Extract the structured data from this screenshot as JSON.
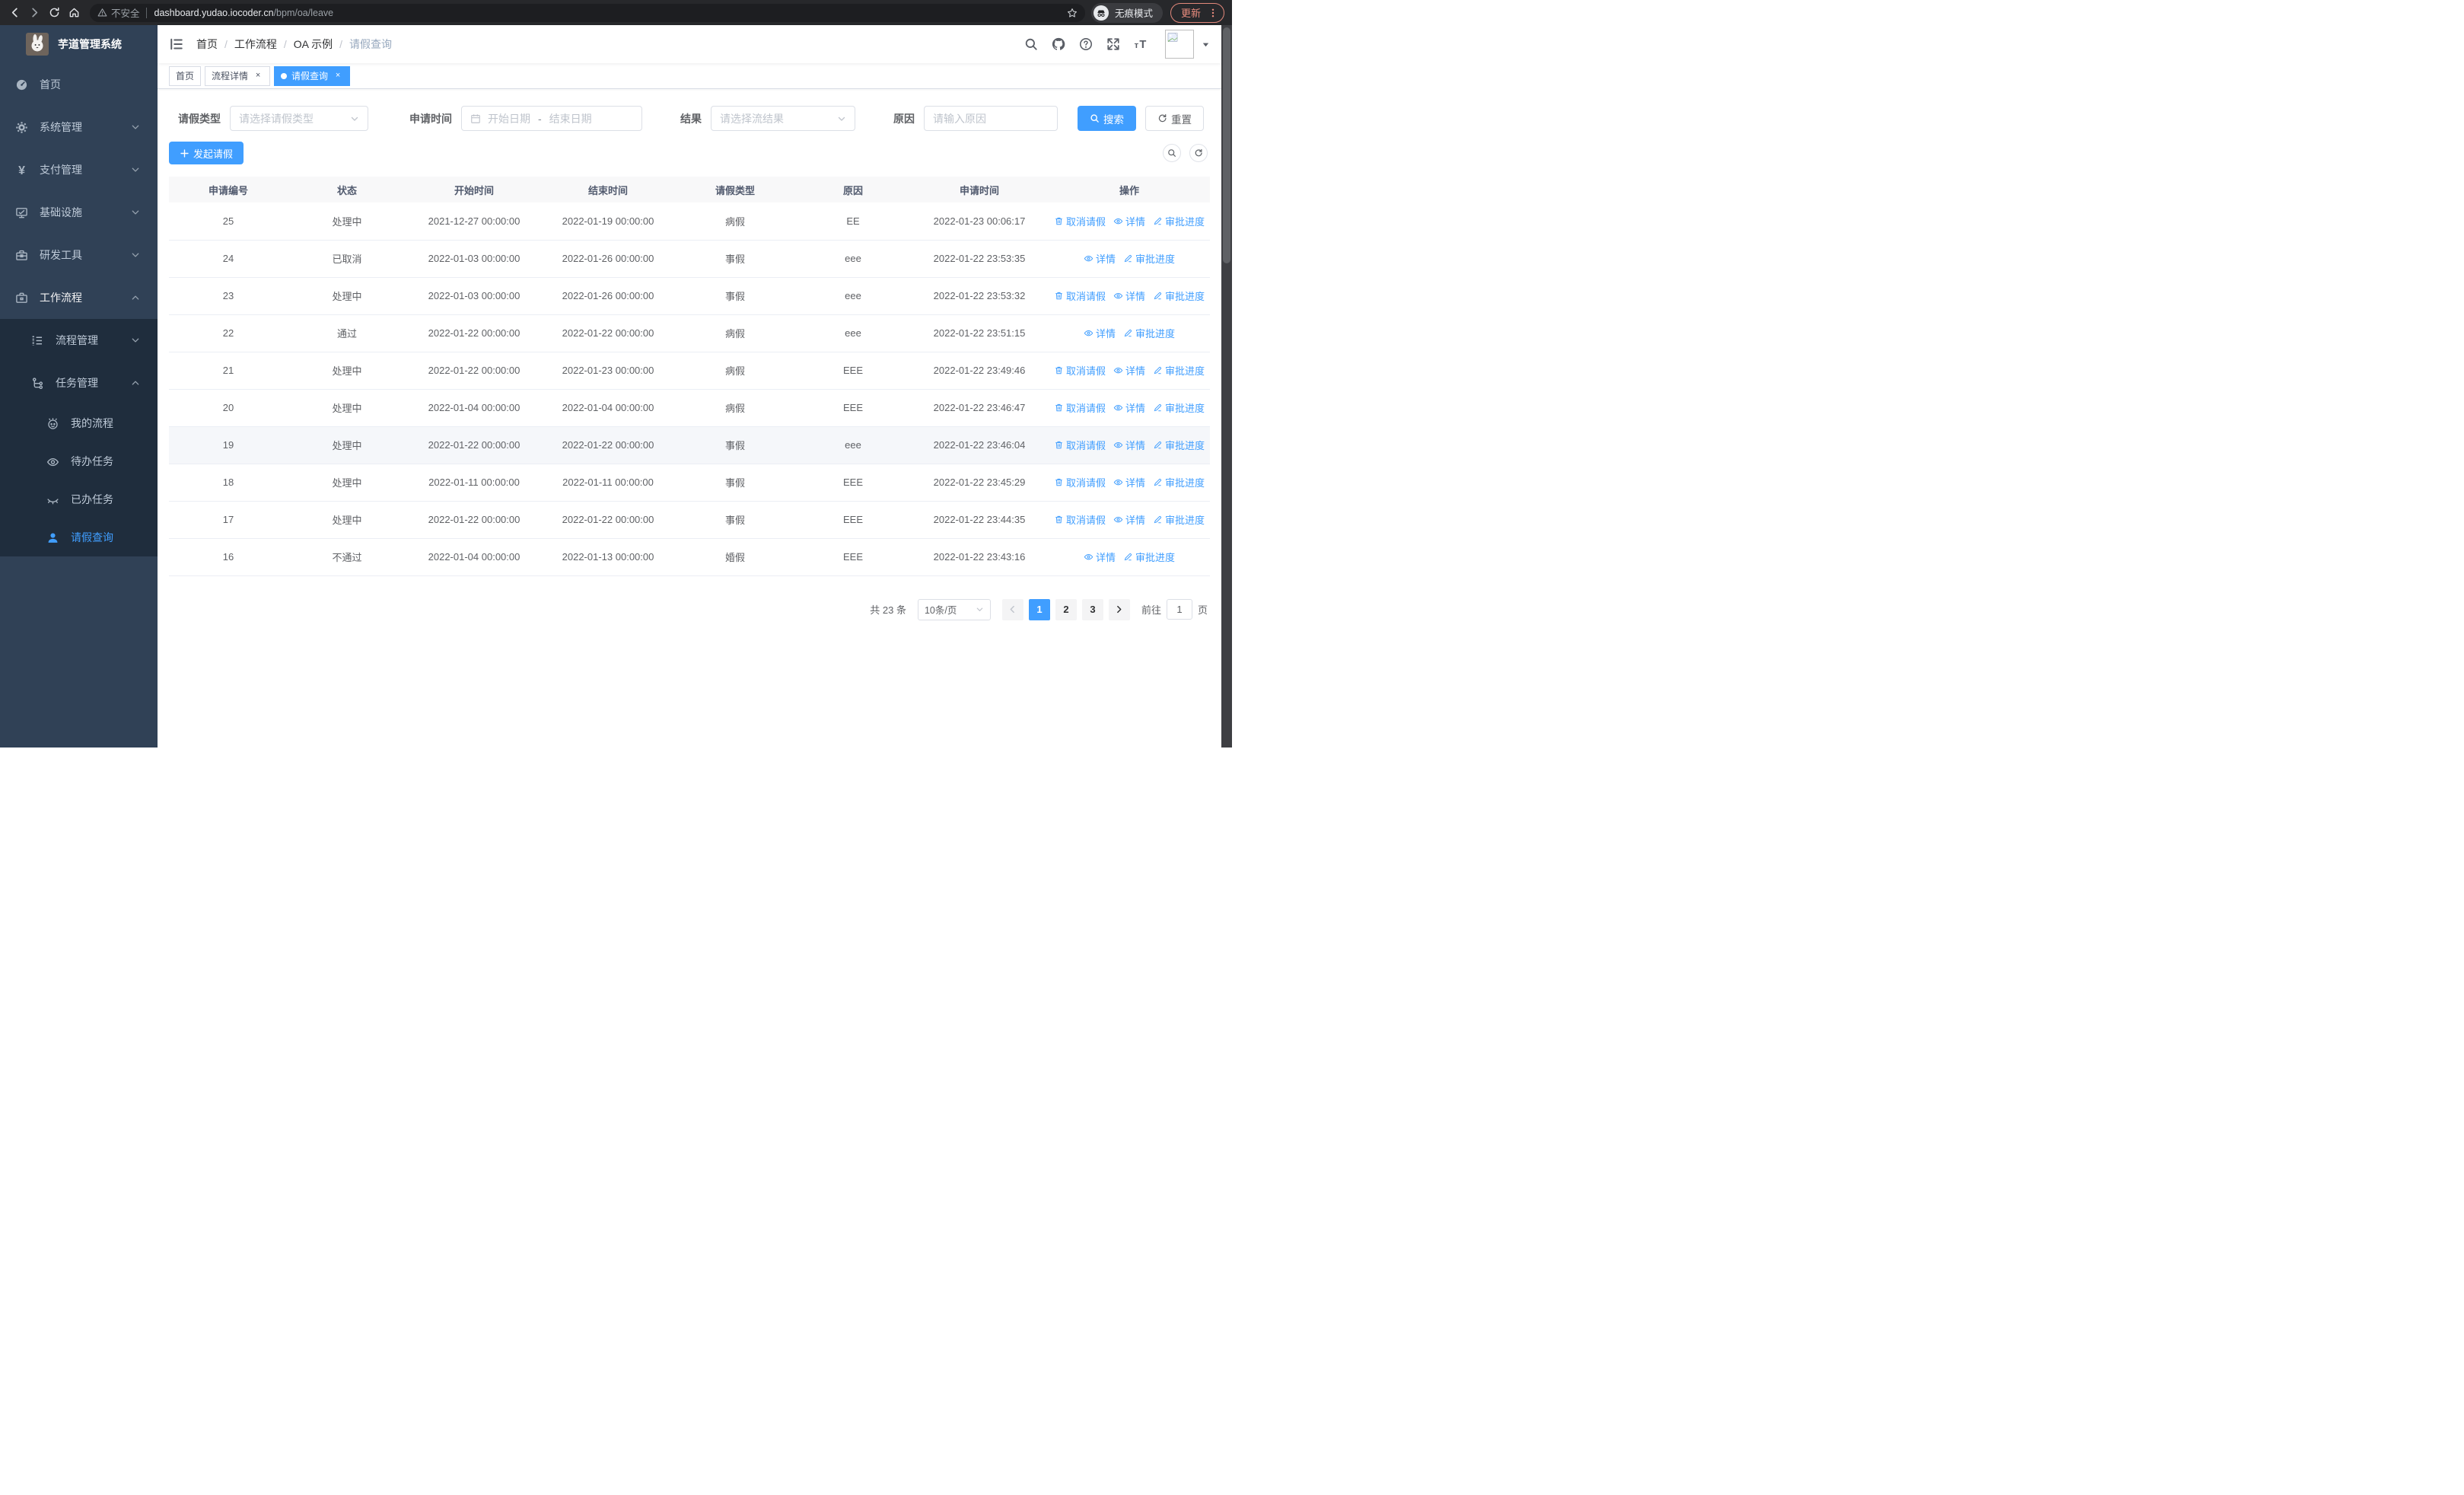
{
  "browser": {
    "security_label": "不安全",
    "url_host": "dashboard.yudao.iocoder.cn",
    "url_path": "/bpm/oa/leave",
    "incognito_label": "无痕模式",
    "update_label": "更新"
  },
  "sidebar": {
    "logo_title": "芋道管理系统",
    "menu": [
      {
        "icon": "gauge-icon",
        "label": "首页",
        "chevron": ""
      },
      {
        "icon": "gear-icon",
        "label": "系统管理",
        "chevron": "down"
      },
      {
        "icon": "yen-icon",
        "label": "支付管理",
        "chevron": "down"
      },
      {
        "icon": "monitor-icon",
        "label": "基础设施",
        "chevron": "down"
      },
      {
        "icon": "toolbox-icon",
        "label": "研发工具",
        "chevron": "down"
      },
      {
        "icon": "briefcase-icon",
        "label": "工作流程",
        "chevron": "up",
        "open": true
      }
    ],
    "submenu": [
      {
        "icon": "list-icon",
        "label": "流程管理",
        "chevron": "down",
        "leaf": false
      },
      {
        "icon": "tree-icon",
        "label": "任务管理",
        "chevron": "up",
        "leaf": false
      },
      {
        "icon": "robot-icon",
        "label": "我的流程",
        "chevron": "",
        "leaf": true
      },
      {
        "icon": "eye-icon",
        "label": "待办任务",
        "chevron": "",
        "leaf": true
      },
      {
        "icon": "eye-closed-icon",
        "label": "已办任务",
        "chevron": "",
        "leaf": true
      },
      {
        "icon": "user-icon",
        "label": "请假查询",
        "chevron": "",
        "leaf": true,
        "active": true
      }
    ]
  },
  "header": {
    "breadcrumb": [
      "首页",
      "工作流程",
      "OA 示例",
      "请假查询"
    ],
    "breadcrumb_separator": "/",
    "tabs": [
      {
        "label": "首页",
        "closable": false,
        "active": false
      },
      {
        "label": "流程详情",
        "closable": true,
        "active": false
      },
      {
        "label": "请假查询",
        "closable": true,
        "active": true
      }
    ]
  },
  "filters": {
    "type_label": "请假类型",
    "type_placeholder": "请选择请假类型",
    "time_label": "申请时间",
    "start_placeholder": "开始日期",
    "range_separator": "-",
    "end_placeholder": "结束日期",
    "result_label": "结果",
    "result_placeholder": "请选择流结果",
    "reason_label": "原因",
    "reason_placeholder": "请输入原因",
    "search_label": "搜索",
    "reset_label": "重置"
  },
  "toolbar": {
    "create_label": "发起请假"
  },
  "table": {
    "columns": [
      "申请编号",
      "状态",
      "开始时间",
      "结束时间",
      "请假类型",
      "原因",
      "申请时间",
      "操作"
    ],
    "action_labels": {
      "cancel": "取消请假",
      "detail": "详情",
      "progress": "审批进度"
    },
    "rows": [
      {
        "id": "25",
        "status": "处理中",
        "start_time": "2021-12-27 00:00:00",
        "end_time": "2022-01-19 00:00:00",
        "leave_type": "病假",
        "reason": "EE",
        "apply_time": "2022-01-23 00:06:17",
        "can_cancel": true,
        "highlighted": false
      },
      {
        "id": "24",
        "status": "已取消",
        "start_time": "2022-01-03 00:00:00",
        "end_time": "2022-01-26 00:00:00",
        "leave_type": "事假",
        "reason": "eee",
        "apply_time": "2022-01-22 23:53:35",
        "can_cancel": false,
        "highlighted": false
      },
      {
        "id": "23",
        "status": "处理中",
        "start_time": "2022-01-03 00:00:00",
        "end_time": "2022-01-26 00:00:00",
        "leave_type": "事假",
        "reason": "eee",
        "apply_time": "2022-01-22 23:53:32",
        "can_cancel": true,
        "highlighted": false
      },
      {
        "id": "22",
        "status": "通过",
        "start_time": "2022-01-22 00:00:00",
        "end_time": "2022-01-22 00:00:00",
        "leave_type": "病假",
        "reason": "eee",
        "apply_time": "2022-01-22 23:51:15",
        "can_cancel": false,
        "highlighted": false
      },
      {
        "id": "21",
        "status": "处理中",
        "start_time": "2022-01-22 00:00:00",
        "end_time": "2022-01-23 00:00:00",
        "leave_type": "病假",
        "reason": "EEE",
        "apply_time": "2022-01-22 23:49:46",
        "can_cancel": true,
        "highlighted": false
      },
      {
        "id": "20",
        "status": "处理中",
        "start_time": "2022-01-04 00:00:00",
        "end_time": "2022-01-04 00:00:00",
        "leave_type": "病假",
        "reason": "EEE",
        "apply_time": "2022-01-22 23:46:47",
        "can_cancel": true,
        "highlighted": false
      },
      {
        "id": "19",
        "status": "处理中",
        "start_time": "2022-01-22 00:00:00",
        "end_time": "2022-01-22 00:00:00",
        "leave_type": "事假",
        "reason": "eee",
        "apply_time": "2022-01-22 23:46:04",
        "can_cancel": true,
        "highlighted": true
      },
      {
        "id": "18",
        "status": "处理中",
        "start_time": "2022-01-11 00:00:00",
        "end_time": "2022-01-11 00:00:00",
        "leave_type": "事假",
        "reason": "EEE",
        "apply_time": "2022-01-22 23:45:29",
        "can_cancel": true,
        "highlighted": false
      },
      {
        "id": "17",
        "status": "处理中",
        "start_time": "2022-01-22 00:00:00",
        "end_time": "2022-01-22 00:00:00",
        "leave_type": "事假",
        "reason": "EEE",
        "apply_time": "2022-01-22 23:44:35",
        "can_cancel": true,
        "highlighted": false
      },
      {
        "id": "16",
        "status": "不通过",
        "start_time": "2022-01-04 00:00:00",
        "end_time": "2022-01-13 00:00:00",
        "leave_type": "婚假",
        "reason": "EEE",
        "apply_time": "2022-01-22 23:43:16",
        "can_cancel": false,
        "highlighted": false
      }
    ]
  },
  "pagination": {
    "total_label": "共 23 条",
    "page_size_label": "10条/页",
    "pages": [
      "1",
      "2",
      "3"
    ],
    "active_page": "1",
    "goto_label": "前往",
    "goto_value": "1",
    "page_unit": "页"
  },
  "colors": {
    "primary": "#409eff",
    "sidebar_bg": "#304156",
    "submenu_bg": "#1f2d3d"
  }
}
